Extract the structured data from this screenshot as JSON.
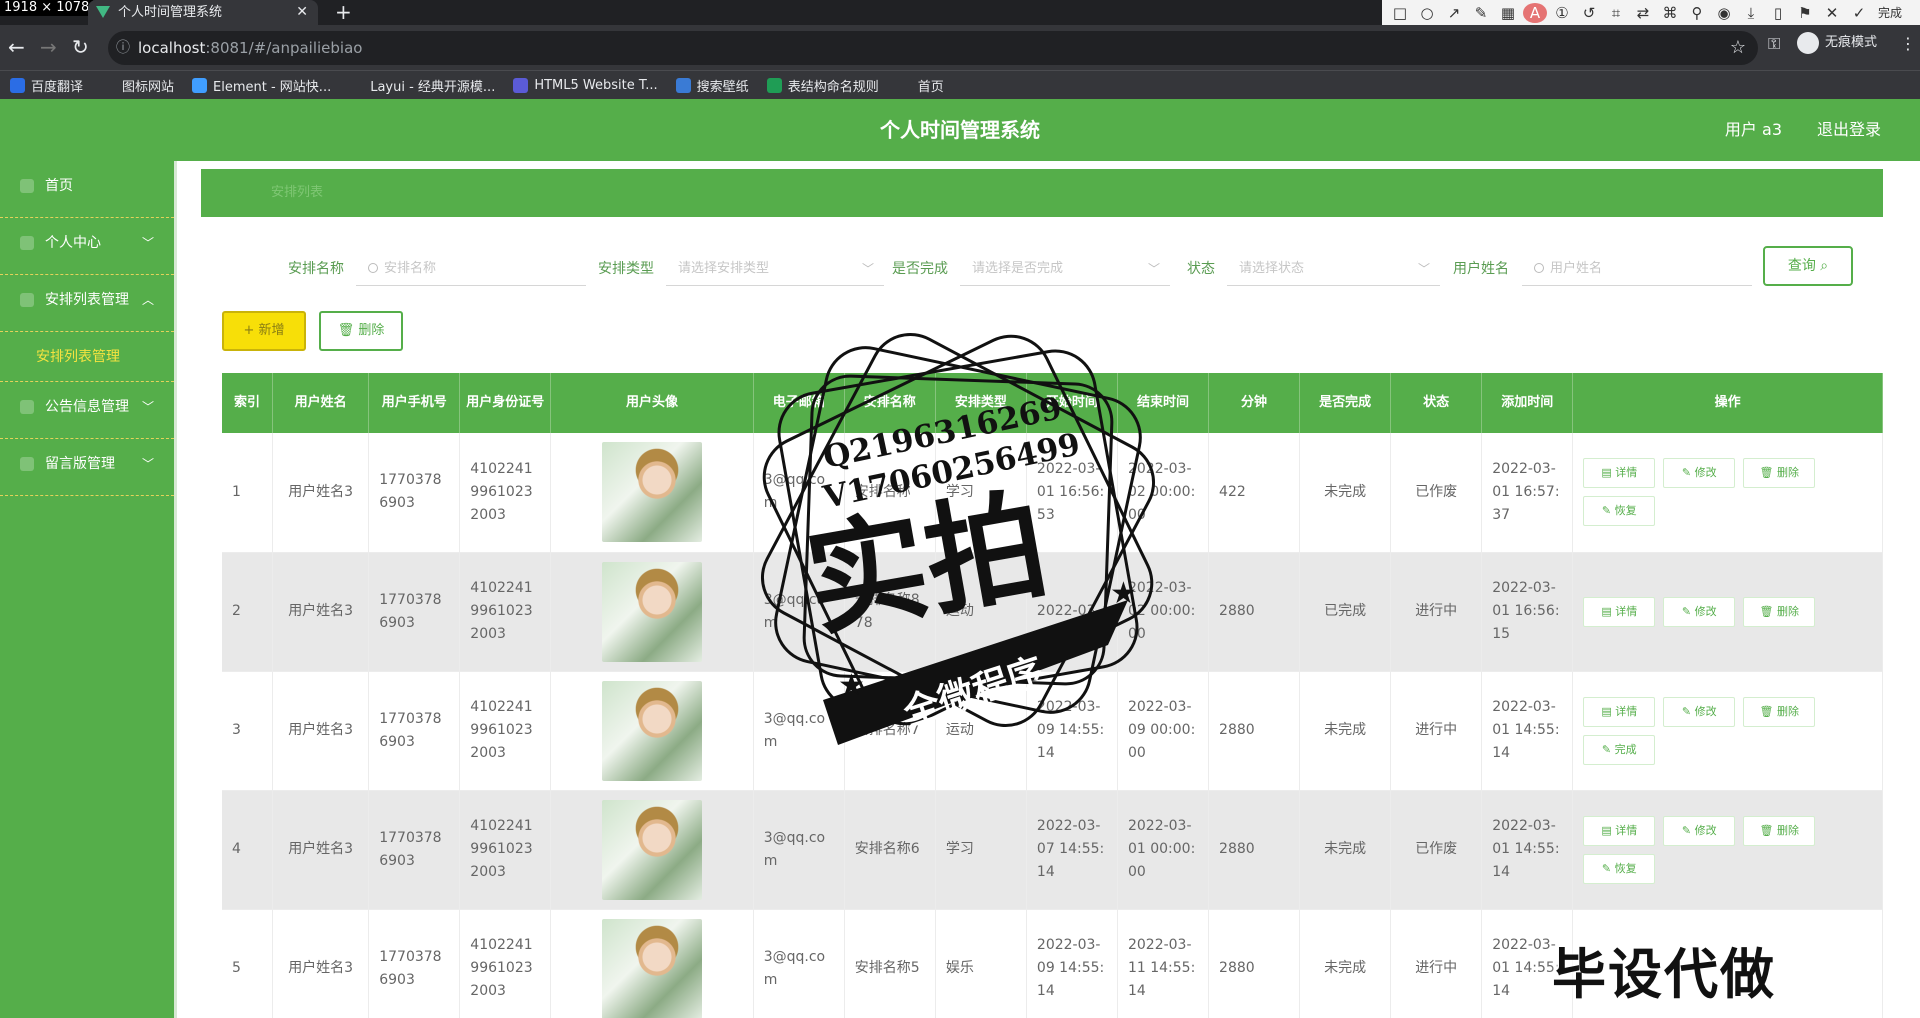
{
  "browser": {
    "size_badge": "1918 × 1078",
    "tab_title": "个人时间管理系统",
    "url_host": "localhost",
    "url_rest": ":8081/#/anpailiebiao",
    "incognito_label": "无痕模式",
    "done_label": "完成",
    "bookmarks": [
      {
        "label": "百度翻译",
        "icon": "baidu-translate-icon",
        "color": "#2b6de5"
      },
      {
        "label": "图标网站",
        "icon": "flag-icon",
        "color": "#35363a"
      },
      {
        "label": "Element - 网站快...",
        "icon": "element-icon",
        "color": "#409eff"
      },
      {
        "label": "Layui - 经典开源模...",
        "icon": "layui-icon",
        "color": "#35363a"
      },
      {
        "label": "HTML5 Website T...",
        "icon": "html5-icon",
        "color": "#5b5bd6"
      },
      {
        "label": "搜索壁纸",
        "icon": "wallpaper-icon",
        "color": "#3a7bd5"
      },
      {
        "label": "表结构命名规则",
        "icon": "sheet-icon",
        "color": "#1f9d55"
      },
      {
        "label": "首页",
        "icon": "github-icon",
        "color": "#35363a"
      }
    ]
  },
  "app": {
    "title": "个人时间管理系统",
    "user_label": "用户 a3",
    "logout_label": "退出登录",
    "theme_color": "#55ae4a"
  },
  "sidebar": {
    "items": [
      {
        "label": "首页",
        "has_arrow": false
      },
      {
        "label": "个人中心",
        "has_arrow": true,
        "arrow": "down"
      },
      {
        "label": "安排列表管理",
        "has_arrow": true,
        "arrow": "up"
      },
      {
        "label": "公告信息管理",
        "has_arrow": true,
        "arrow": "down"
      },
      {
        "label": "留言版管理",
        "has_arrow": true,
        "arrow": "down"
      }
    ],
    "sub_item": "安排列表管理"
  },
  "breadcrumb": "安排列表",
  "search": {
    "name_label": "安排名称",
    "name_placeholder": "安排名称",
    "type_label": "安排类型",
    "type_placeholder": "请选择安排类型",
    "done_label": "是否完成",
    "done_placeholder": "请选择是否完成",
    "status_label": "状态",
    "status_placeholder": "请选择状态",
    "username_label": "用户姓名",
    "username_placeholder": "用户姓名",
    "query_label": "查询"
  },
  "actions": {
    "add": "+ 新增",
    "delete": "删除"
  },
  "table": {
    "headers": [
      "索引",
      "用户姓名",
      "用户手机号",
      "用户身份证号",
      "用户头像",
      "电子邮箱",
      "安排名称",
      "安排类型",
      "开始时间",
      "结束时间",
      "分钟",
      "是否完成",
      "状态",
      "添加时间",
      "操作"
    ],
    "rows": [
      {
        "idx": "1",
        "name": "用户姓名3",
        "phone": "17703786903",
        "idcard": "410224199610232003",
        "email": "3@qq.com",
        "plan": "安排名称",
        "type": "学习",
        "start": "2022-03-01 16:56:53",
        "end": "2022-03-02 00:00:00",
        "minutes": "422",
        "done": "未完成",
        "status": "已作废",
        "added": "2022-03-01 16:57:37",
        "ops": [
          "详情",
          "修改",
          "删除",
          "恢复"
        ]
      },
      {
        "idx": "2",
        "name": "用户姓名3",
        "phone": "17703786903",
        "idcard": "410224199610232003",
        "email": "3@qq.com",
        "plan": "安排名称878",
        "type": "运动",
        "start": "2022-03-",
        "end": "2022-03-02 00:00:00",
        "minutes": "2880",
        "done": "已完成",
        "status": "进行中",
        "added": "2022-03-01 16:56:15",
        "ops": [
          "详情",
          "修改",
          "删除"
        ]
      },
      {
        "idx": "3",
        "name": "用户姓名3",
        "phone": "17703786903",
        "idcard": "410224199610232003",
        "email": "3@qq.com",
        "plan": "安排名称7",
        "type": "运动",
        "start": "2022-03-09 14:55:14",
        "end": "2022-03-09 00:00:00",
        "minutes": "2880",
        "done": "未完成",
        "status": "进行中",
        "added": "2022-03-01 14:55:14",
        "ops": [
          "详情",
          "修改",
          "删除",
          "完成"
        ]
      },
      {
        "idx": "4",
        "name": "用户姓名3",
        "phone": "17703786903",
        "idcard": "410224199610232003",
        "email": "3@qq.com",
        "plan": "安排名称6",
        "type": "学习",
        "start": "2022-03-07 14:55:14",
        "end": "2022-03-01 00:00:00",
        "minutes": "2880",
        "done": "未完成",
        "status": "已作废",
        "added": "2022-03-01 14:55:14",
        "ops": [
          "详情",
          "修改",
          "删除",
          "恢复"
        ]
      },
      {
        "idx": "5",
        "name": "用户姓名3",
        "phone": "17703786903",
        "idcard": "410224199610232003",
        "email": "3@qq.com",
        "plan": "安排名称5",
        "type": "娱乐",
        "start": "2022-03-09 14:55:14",
        "end": "2022-03-11 14:55:14",
        "minutes": "2880",
        "done": "未完成",
        "status": "进行中",
        "added": "2022-03-01 14:55:14",
        "ops": []
      }
    ]
  },
  "watermark": {
    "line1": "Q2196316269",
    "line2": "V17060256499",
    "big": "实拍",
    "banner": "全微程序",
    "caption": "毕设代做"
  }
}
